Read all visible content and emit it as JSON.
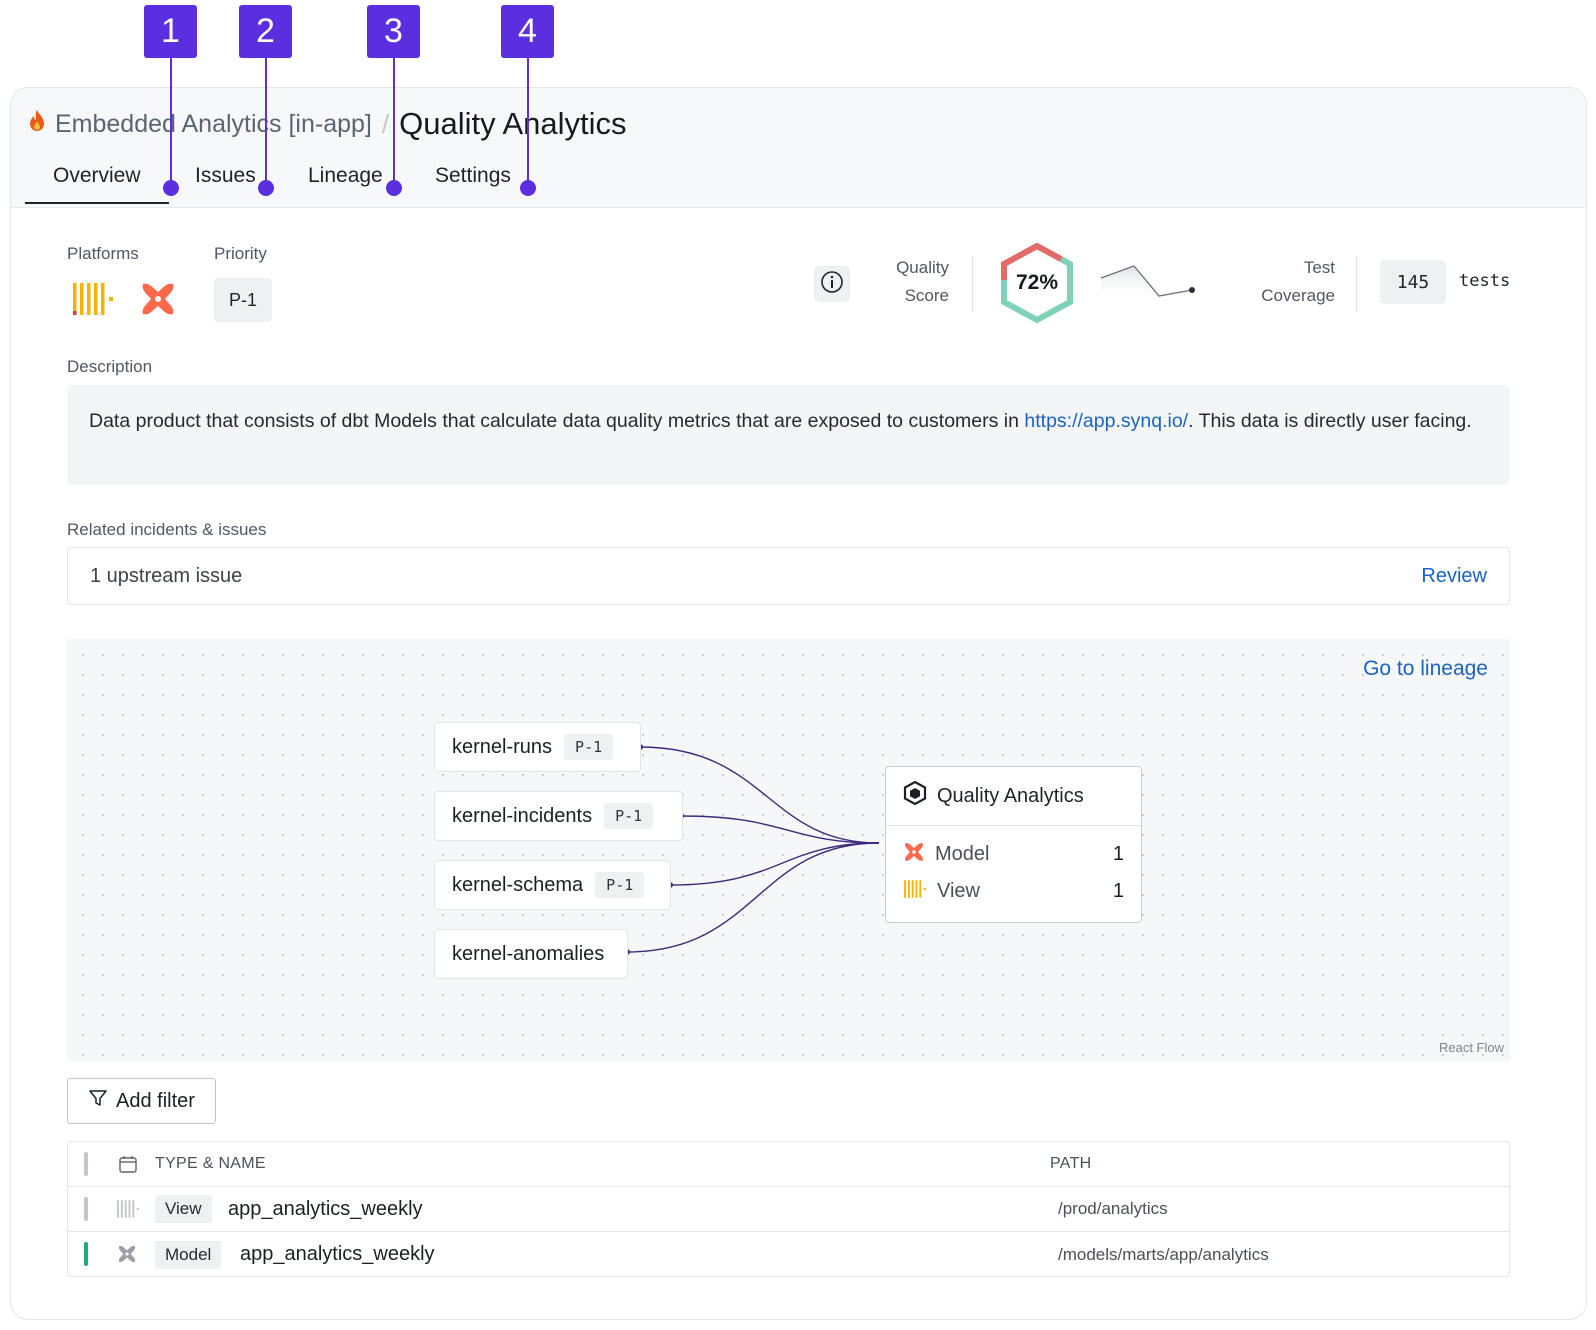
{
  "callouts": [
    "1",
    "2",
    "3",
    "4"
  ],
  "breadcrumb": {
    "parent": "Embedded Analytics [in-app]",
    "separator": "/",
    "title": "Quality Analytics"
  },
  "tabs": [
    {
      "label": "Overview",
      "active": true
    },
    {
      "label": "Issues"
    },
    {
      "label": "Lineage"
    },
    {
      "label": "Settings"
    }
  ],
  "platforms": {
    "label": "Platforms",
    "icons": [
      "looker-icon",
      "dbt-icon"
    ]
  },
  "priority": {
    "label": "Priority",
    "value": "P-1"
  },
  "quality": {
    "label_line1": "Quality",
    "label_line2": "Score",
    "value": "72%",
    "fraction": 0.72
  },
  "coverage": {
    "label_line1": "Test",
    "label_line2": "Coverage",
    "count": "145",
    "unit": "tests"
  },
  "description": {
    "label": "Description",
    "text_before": "Data product that consists of dbt Models that calculate data quality metrics that are exposed to customers in ",
    "link": "https://app.synq.io/",
    "text_after": ". This data is directly user facing."
  },
  "related": {
    "label": "Related incidents & issues",
    "text": "1 upstream issue",
    "action": "Review"
  },
  "lineage": {
    "goto": "Go to lineage",
    "watermark": "React Flow",
    "sources": [
      {
        "name": "kernel-runs",
        "priority": "P-1"
      },
      {
        "name": "kernel-incidents",
        "priority": "P-1"
      },
      {
        "name": "kernel-schema",
        "priority": "P-1"
      },
      {
        "name": "kernel-anomalies",
        "priority": ""
      }
    ],
    "target": {
      "title": "Quality Analytics",
      "rows": [
        {
          "name": "Model",
          "count": "1"
        },
        {
          "name": "View",
          "count": "1"
        }
      ]
    }
  },
  "filter": {
    "label": "Add filter"
  },
  "table": {
    "headers": {
      "type_name": "TYPE & NAME",
      "path": "PATH"
    },
    "rows": [
      {
        "type": "View",
        "name": "app_analytics_weekly",
        "path": "/prod/analytics",
        "status_color": "#c2c6cb"
      },
      {
        "type": "Model",
        "name": "app_analytics_weekly",
        "path": "/models/marts/app/analytics",
        "status_color": "#1fa97a"
      }
    ]
  },
  "colors": {
    "accent": "#5b2ee0",
    "link": "#1b63c6",
    "score_good": "#7fd1b8",
    "score_bad": "#e46a6a"
  }
}
